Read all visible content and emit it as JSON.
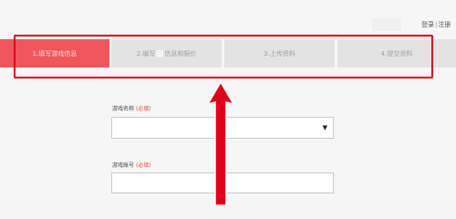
{
  "header": {
    "links": [
      "登录",
      "注册"
    ],
    "separator": "|"
  },
  "steps": [
    {
      "label": "1.填写游戏信息",
      "active": true
    },
    {
      "label_before": "2.编写",
      "label_after": "信息和报价"
    },
    {
      "label": "3.上传资料"
    },
    {
      "label": "4.提交资料"
    }
  ],
  "form": {
    "game_name": {
      "label": "游戏名称",
      "required": "(必填)",
      "caret": "▼"
    },
    "game_account": {
      "label": "游戏账号",
      "required": "(必填)"
    }
  },
  "colors": {
    "active_step": "#f0565a",
    "inactive_step": "#e3e3e3",
    "annotation": "#e0001a"
  }
}
